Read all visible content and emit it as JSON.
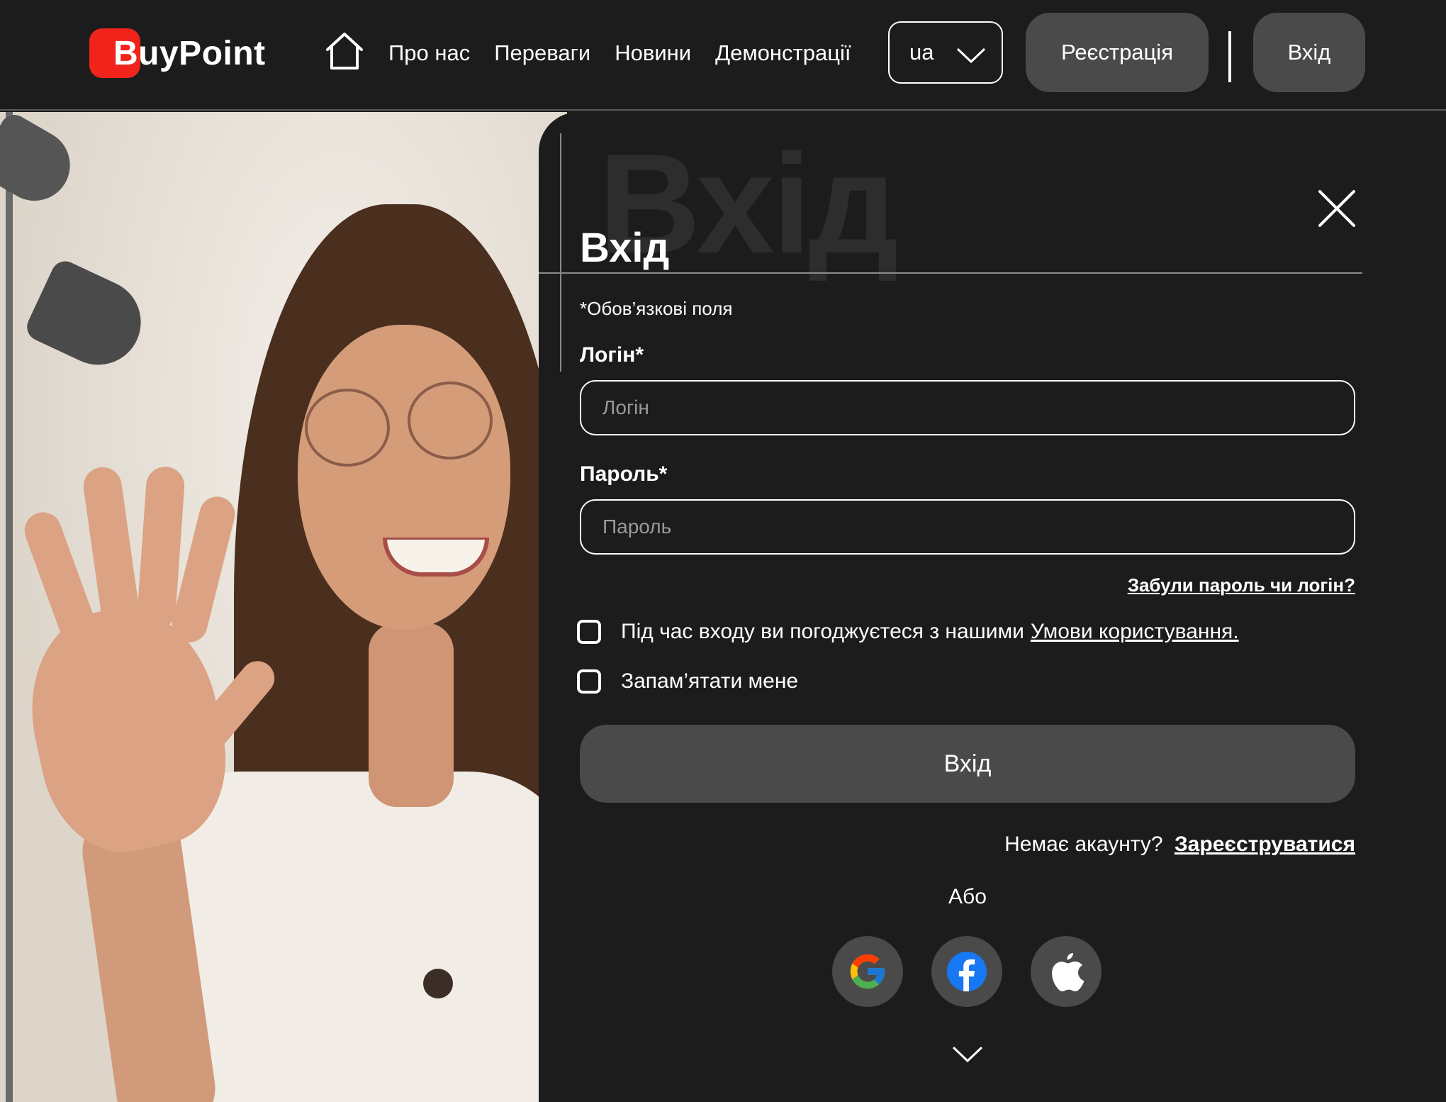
{
  "header": {
    "logo_text": "BuyPoint",
    "nav": [
      "Про нас",
      "Переваги",
      "Новини",
      "Демонстрації"
    ],
    "language": "ua",
    "register_label": "Реєстрація",
    "login_label": "Вхід"
  },
  "modal": {
    "watermark": "Вхід",
    "title": "Вхід",
    "required_note": "*Обов’язкові поля",
    "login_label": "Логін*",
    "login_placeholder": "Логін",
    "password_label": "Пароль*",
    "password_placeholder": "Пароль",
    "forgot_link": "Забули пароль чи логін?",
    "terms_text": "Під час входу ви погоджуєтеся з нашими",
    "terms_link": "Умови користування.",
    "terms_checked": false,
    "remember_text": "Запам’ятати мене",
    "remember_checked": false,
    "submit_label": "Вхід",
    "no_account_text": "Немає акаунту?",
    "register_link": "Зареєструватися",
    "or_text": "Або",
    "socials": [
      "google-icon",
      "facebook-icon",
      "apple-icon"
    ]
  },
  "colors": {
    "background": "#1c1c1c",
    "button_gray": "#4a4a4a",
    "brand_red": "#f0241b",
    "facebook_blue": "#1877f2"
  }
}
